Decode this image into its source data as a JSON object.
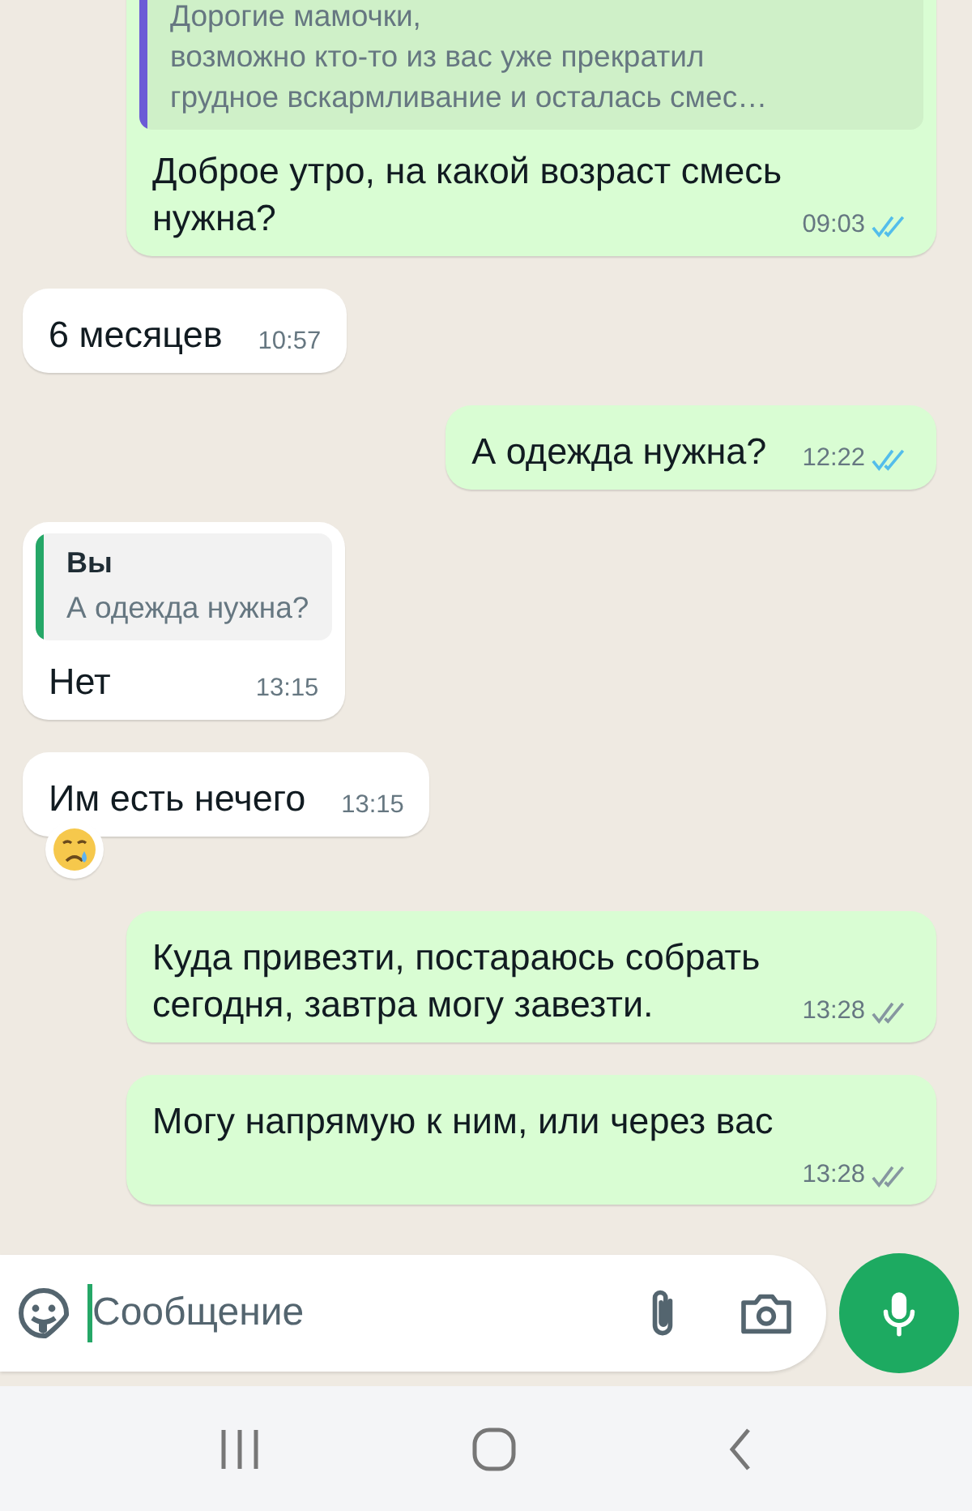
{
  "messages": [
    {
      "kind": "outgoing",
      "quote": {
        "text": "Дорогие мамочки,\nвозможно кто-то из вас уже прекратил\nгрудное вскармливание и осталась смес…",
        "color": "#6b5bd6"
      },
      "text": "Доброе утро, на какой возраст смесь нужна?",
      "time": "09:03",
      "read": true
    },
    {
      "kind": "incoming",
      "text": "6 месяцев",
      "time": "10:57"
    },
    {
      "kind": "outgoing",
      "text": "А одежда нужна?",
      "time": "12:22",
      "read": true
    },
    {
      "kind": "incoming",
      "quote": {
        "author": "Вы",
        "text": "А одежда нужна?",
        "color": "#25a767"
      },
      "text": "Нет",
      "time": "13:15"
    },
    {
      "kind": "incoming",
      "text": "Им есть нечего",
      "time": "13:15",
      "reaction": true
    },
    {
      "kind": "outgoing",
      "text": "Куда привезти, постараюсь собрать сегодня, завтра могу завезти.",
      "time": "13:28",
      "read": false
    },
    {
      "kind": "outgoing",
      "text": "Могу напрямую к ним, или через вас",
      "time": "13:28",
      "read": false
    }
  ],
  "composer": {
    "placeholder": "Сообщение"
  }
}
